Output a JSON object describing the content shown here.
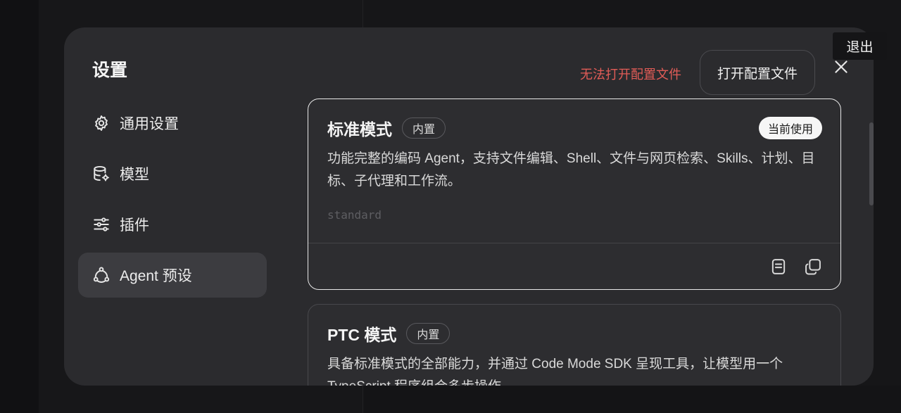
{
  "tooltip": {
    "text": "退出"
  },
  "modal": {
    "title": "设置",
    "nav": [
      {
        "label": "通用设置",
        "icon": "gear-icon",
        "active": false
      },
      {
        "label": "模型",
        "icon": "database-gear-icon",
        "active": false
      },
      {
        "label": "插件",
        "icon": "sliders-icon",
        "active": false
      },
      {
        "label": "Agent 预设",
        "icon": "agent-nodes-icon",
        "active": true
      }
    ],
    "topbar": {
      "error_text": "无法打开配置文件",
      "open_config_label": "打开配置文件"
    },
    "presets": [
      {
        "title": "标准模式",
        "badge": "内置",
        "current_label": "当前使用",
        "description": "功能完整的编码 Agent，支持文件编辑、Shell、文件与网页检索、Skills、计划、目标、子代理和工作流。",
        "id": "standard"
      },
      {
        "title": "PTC 模式",
        "badge": "内置",
        "description": "具备标准模式的全部能力，并通过 Code Mode SDK 呈现工具，让模型用一个 TypeScript 程序组合多步操作。"
      }
    ]
  },
  "colors": {
    "error": "#e25c57",
    "modal_bg": "#2b2b2e",
    "active_nav": "#3c3c40",
    "selected_border": "#e8e8e8"
  }
}
